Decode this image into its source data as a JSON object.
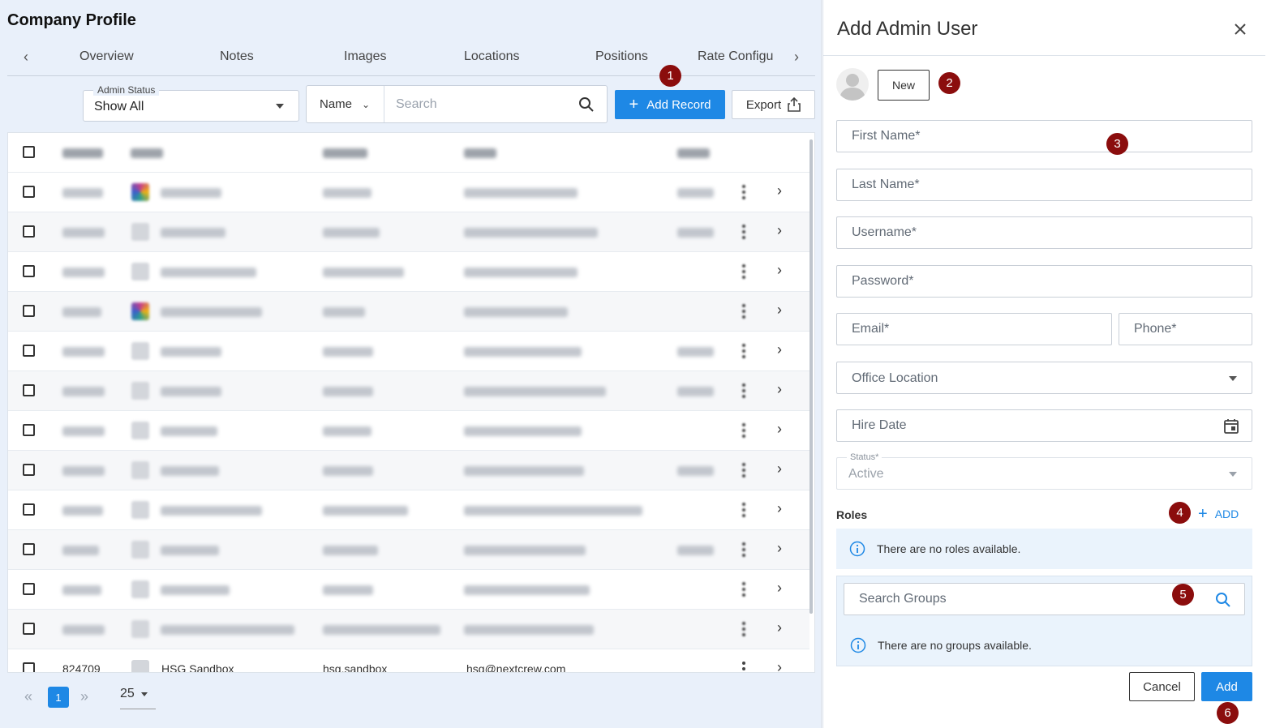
{
  "page": {
    "title": "Company Profile"
  },
  "tabs": [
    "Overview",
    "Notes",
    "Images",
    "Locations",
    "Positions",
    "Rate Configu"
  ],
  "filters": {
    "admin_status_label": "Admin Status",
    "admin_status_value": "Show All",
    "search_by": "Name",
    "search_placeholder": "Search"
  },
  "toolbar": {
    "add_record": "Add Record",
    "export": "Export"
  },
  "table": {
    "last_row": {
      "id": "824709",
      "name": "HSG Sandbox",
      "login": "hsg.sandbox",
      "email": "hsg@nextcrew.com"
    }
  },
  "pager": {
    "current_page": "1",
    "per_page": "25"
  },
  "dialog": {
    "title": "Add Admin User",
    "new_button": "New",
    "fields": {
      "first_name": "First Name*",
      "last_name": "Last Name*",
      "username": "Username*",
      "password": "Password*",
      "email": "Email*",
      "phone": "Phone*",
      "office_location": "Office Location",
      "hire_date": "Hire Date"
    },
    "status_label": "Status*",
    "status_value": "Active",
    "roles_label": "Roles",
    "roles_add": "ADD",
    "roles_empty": "There are no roles available.",
    "groups_placeholder": "Search Groups",
    "groups_empty": "There are no groups available.",
    "cancel": "Cancel",
    "add": "Add"
  },
  "markers": [
    "1",
    "2",
    "3",
    "4",
    "5",
    "6"
  ],
  "colors": {
    "primary": "#1e88e5",
    "marker": "#8b0d0d",
    "panel_bg": "#e9f0fa"
  },
  "icons": [
    "chevron-left-icon",
    "chevron-right-icon",
    "search-icon",
    "plus-icon",
    "export-icon",
    "close-icon",
    "calendar-icon",
    "info-icon",
    "kebab-icon",
    "user-avatar-icon"
  ]
}
